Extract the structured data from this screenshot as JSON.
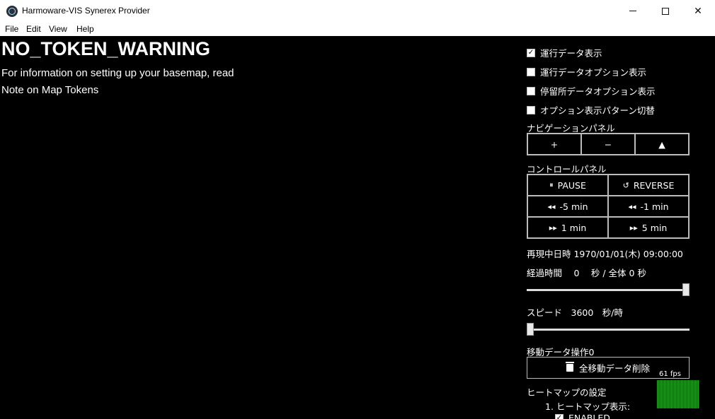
{
  "window": {
    "title": "Harmoware-VIS Synerex Provider"
  },
  "menu": {
    "items": [
      "File",
      "Edit",
      "View",
      "Help"
    ]
  },
  "warning": {
    "title": "NO_TOKEN_WARNING",
    "line1": "For information on setting up your basemap, read",
    "line2": "Note on Map Tokens"
  },
  "panel": {
    "checkboxes": [
      {
        "label": "運行データ表示",
        "checked": true
      },
      {
        "label": "運行データオプション表示",
        "checked": false
      },
      {
        "label": "停留所データオプション表示",
        "checked": false
      },
      {
        "label": "オプション表示パターン切替",
        "checked": false
      }
    ],
    "nav_title": "ナビゲーションパネル",
    "nav_buttons": [
      "+",
      "−",
      "▲"
    ],
    "control_title": "コントロールパネル",
    "pause_label": "PAUSE",
    "reverse_label": "REVERSE",
    "back5_label": "-5 min",
    "back1_label": "-1 min",
    "fwd1_label": "1 min",
    "fwd5_label": "5 min",
    "playback_time": "再現中日時 1970/01/01(木) 09:00:00",
    "elapsed": "経過時間　 0　 秒 / 全体 0 秒",
    "elapsed_slider_value": 1.0,
    "speed": "スピード　3600　秒/時",
    "speed_slider_value": 0.0,
    "move_data_title": "移動データ操作0",
    "delete_label": "全移動データ削除",
    "heatmap_title": "ヒートマップの設定",
    "heatmap_item": "1. ヒートマップ表示:",
    "heatmap_enabled": "ENABLED",
    "fps": "61 fps"
  }
}
